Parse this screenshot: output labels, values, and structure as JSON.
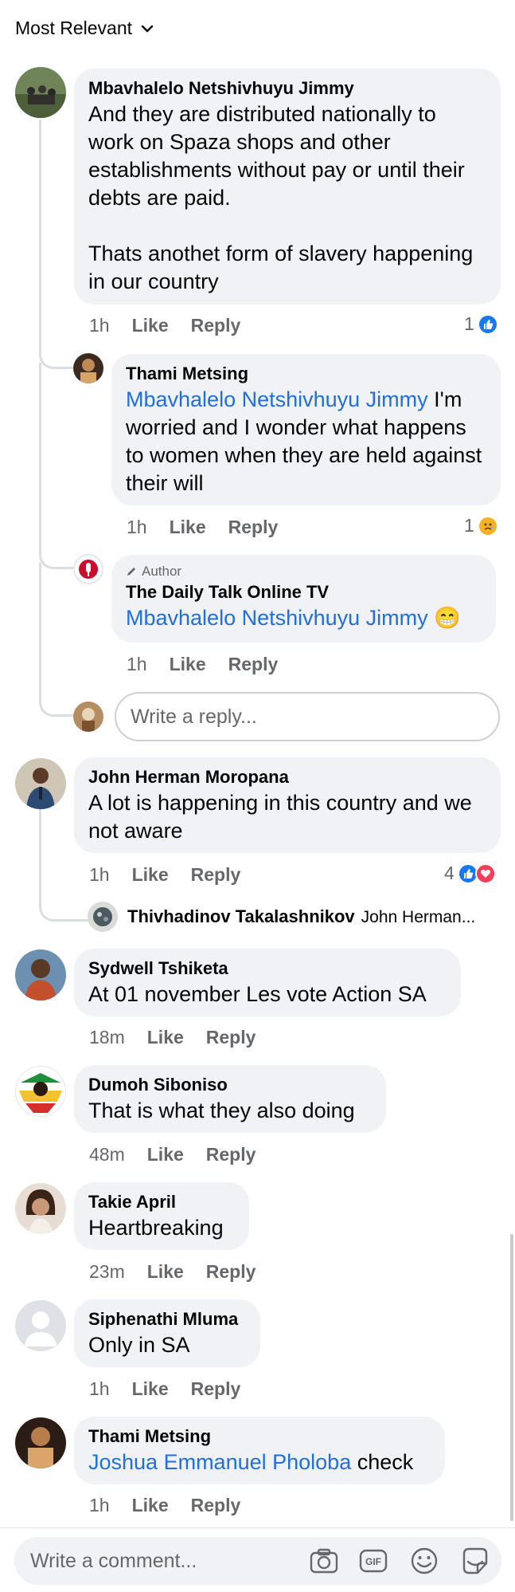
{
  "sort": {
    "label": "Most Relevant"
  },
  "comments": [
    {
      "name": "Mbavhalelo Netshivhuyu Jimmy",
      "text1": "And they are distributed nationally to work on Spaza shops and other establishments without pay or until their debts are paid.",
      "text2": "Thats anothet form of slavery happening in our country",
      "time": "1h",
      "like": "Like",
      "reply": "Reply",
      "reactions": "1"
    },
    {
      "name": "Thami Metsing",
      "mention": "Mbavhalelo Netshivhuyu Jimmy",
      "text": " I'm worried and I wonder what happens to women when they are held against their will",
      "time": "1h",
      "like": "Like",
      "reply": "Reply",
      "reactions": "1"
    },
    {
      "badge": "Author",
      "name": "The Daily Talk Online TV",
      "mention": "Mbavhalelo Netshivhuyu Jimmy",
      "emoji": "😁",
      "time": "1h",
      "like": "Like",
      "reply": "Reply"
    },
    {
      "name": "John Herman Moropana",
      "text": "A lot is happening in this country and we not aware",
      "time": "1h",
      "like": "Like",
      "reply": "Reply",
      "reactions": "4"
    },
    {
      "name": "Thivhadinov Takalashnikov",
      "preview": "John Herman..."
    },
    {
      "name": "Sydwell Tshiketa",
      "text": "At 01 november Les  vote Action SA",
      "time": "18m",
      "like": "Like",
      "reply": "Reply"
    },
    {
      "name": "Dumoh Siboniso",
      "text": "That is what they also doing",
      "time": "48m",
      "like": "Like",
      "reply": "Reply"
    },
    {
      "name": "Takie April",
      "text": "Heartbreaking",
      "time": "23m",
      "like": "Like",
      "reply": "Reply"
    },
    {
      "name": "Siphenathi Mluma",
      "text": "Only in SA",
      "time": "1h",
      "like": "Like",
      "reply": "Reply"
    },
    {
      "name": "Thami Metsing",
      "mention": "Joshua Emmanuel Pholoba",
      "text": " check",
      "time": "1h",
      "like": "Like",
      "reply": "Reply"
    }
  ],
  "reply_input": {
    "placeholder": "Write a reply..."
  },
  "comment_input": {
    "placeholder": "Write a comment..."
  },
  "colors": {
    "link": "#216fdb",
    "bubble": "#f0f2f5",
    "meta": "#65676b",
    "like_blue": "#1877f2",
    "love_red": "#f33e58"
  }
}
